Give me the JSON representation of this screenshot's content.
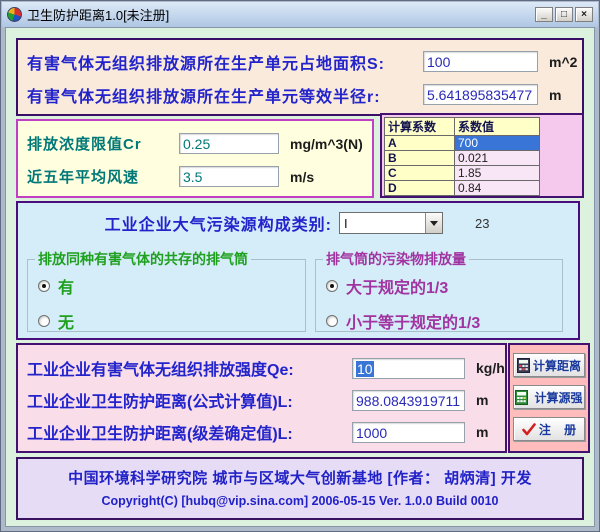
{
  "window": {
    "title": "卫生防护距离1.0[未注册]",
    "controls": {
      "minimize": "_",
      "maximize": "□",
      "close": "×"
    }
  },
  "source_panel": {
    "rows": [
      {
        "label": "有害气体无组织排放源所在生产单元占地面积S:",
        "value": "100",
        "unit": "m^2"
      },
      {
        "label": "有害气体无组织排放源所在生产单元等效半径r:",
        "value": "5.641895835477",
        "unit": "m"
      }
    ]
  },
  "params_panel": {
    "rows": [
      {
        "label": "排放浓度限值Cr",
        "value": "0.25",
        "unit": "mg/m^3(N)"
      },
      {
        "label": "近五年平均风速",
        "value": "3.5",
        "unit": "m/s"
      }
    ]
  },
  "coeff_table": {
    "headers": [
      "计算系数",
      "系数值"
    ],
    "rows": [
      {
        "name": "A",
        "value": "700",
        "selected": true
      },
      {
        "name": "B",
        "value": "0.021",
        "selected": false
      },
      {
        "name": "C",
        "value": "1.85",
        "selected": false
      },
      {
        "name": "D",
        "value": "0.84",
        "selected": false
      }
    ]
  },
  "category": {
    "label": "工业企业大气污染源构成类别:",
    "value": "I",
    "note": "23"
  },
  "stacks_group": {
    "title": "排放同种有害气体的共存的排气筒",
    "options": [
      {
        "label": "有",
        "checked": true
      },
      {
        "label": "无",
        "checked": false
      }
    ]
  },
  "emission_group": {
    "title": "排气筒的污染物排放量",
    "options": [
      {
        "label": "大于规定的1/3",
        "checked": true
      },
      {
        "label": "小于等于规定的1/3",
        "checked": false
      }
    ]
  },
  "results_panel": {
    "rows": [
      {
        "label": "工业企业有害气体无组织排放强度Qe:",
        "value": "10",
        "unit": "kg/h"
      },
      {
        "label": "工业企业卫生防护距离(公式计算值)L:",
        "value": "988.0843919711",
        "unit": "m"
      },
      {
        "label": "工业企业卫生防护距离(级差确定值)L:",
        "value": "1000",
        "unit": "m"
      }
    ]
  },
  "actions": {
    "calc_distance": "计算距离",
    "calc_source": "计算源强",
    "register": "注    册"
  },
  "footer": {
    "line1": "中国环境科学研究院 城市与区域大气创新基地 [作者： 胡炳清] 开发",
    "line2": "Copyright(C) [hubq@vip.sina.com] 2006-05-15 Ver. 1.0.0 Build 0010"
  },
  "colors": {
    "selection_blue": "#3875D7",
    "label_blue": "#2323CC",
    "teal": "#007878",
    "green": "#1FA01F",
    "purple": "#A034A0",
    "panel_border_dark": "#43116F",
    "panel_border_magenta": "#C03FC2"
  }
}
